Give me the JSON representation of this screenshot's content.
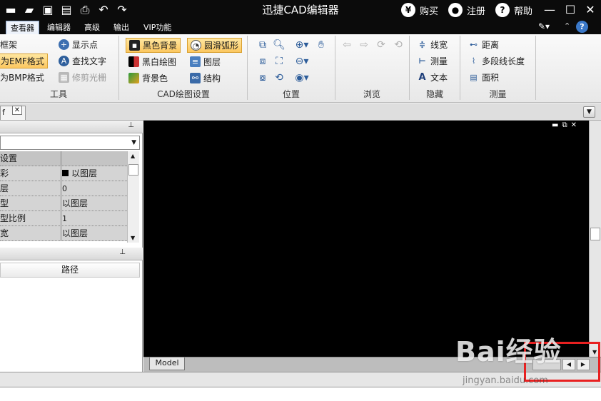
{
  "title_bar": {
    "title": "迅捷CAD编辑器",
    "buy": "购买",
    "register": "注册",
    "help": "帮助",
    "buy_icon_glyph": "¥",
    "help_icon_glyph": "?"
  },
  "menu_tabs": [
    "查看器",
    "编辑器",
    "高级",
    "输出",
    "VIP功能"
  ],
  "ribbon": {
    "tools": {
      "items": [
        "框架",
        "为EMF格式",
        "为BMP格式",
        "显示点",
        "查找文字",
        "修剪光栅"
      ],
      "label": "工具"
    },
    "cad_settings": {
      "items": [
        "黑色背景",
        "黑白绘图",
        "背景色",
        "圆滑弧形",
        "图层",
        "结构"
      ],
      "label": "CAD绘图设置"
    },
    "position": {
      "label": "位置"
    },
    "browse": {
      "label": "浏览"
    },
    "hide": {
      "items": [
        "线宽",
        "测量",
        "文本"
      ],
      "label": "隐藏"
    },
    "measure": {
      "items": [
        "距离",
        "多段线长度",
        "面积"
      ],
      "label": "测量"
    }
  },
  "doc_tab": {
    "name": "f"
  },
  "properties": {
    "header": "设置",
    "rows": [
      {
        "k": "彩",
        "v": "以图层"
      },
      {
        "k": "层",
        "v": "0"
      },
      {
        "k": "型",
        "v": "以图层"
      },
      {
        "k": "型比例",
        "v": "1"
      },
      {
        "k": "宽",
        "v": "以图层"
      }
    ]
  },
  "panel2": {
    "column": "路径"
  },
  "model_tab": "Model",
  "watermark": {
    "logo": "Bai经验",
    "url": "jingyan.baidu.com"
  },
  "colors": {
    "titlebar": "#0b0b0b",
    "canvas": "#000000",
    "highlight": "#fcc760",
    "annotation": "#e82020"
  }
}
